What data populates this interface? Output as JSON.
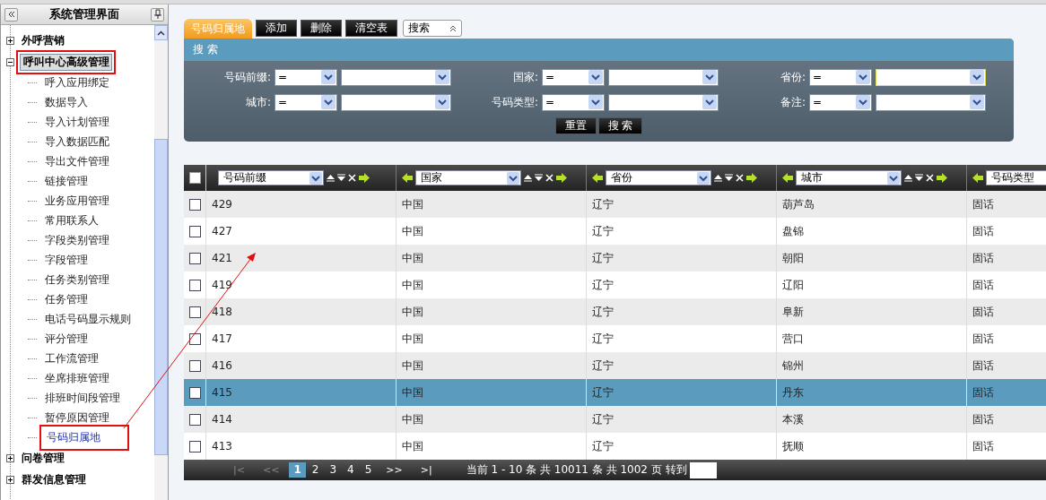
{
  "sidebar": {
    "title": "系统管理界面",
    "items": [
      {
        "label": "外呼营销",
        "expanded": false,
        "selected": false,
        "annotated": false
      },
      {
        "label": "呼叫中心高级管理",
        "expanded": true,
        "selected": true,
        "annotated": true,
        "children": [
          {
            "label": "呼入应用绑定",
            "selected": false,
            "annotated": false
          },
          {
            "label": "数据导入",
            "selected": false,
            "annotated": false
          },
          {
            "label": "导入计划管理",
            "selected": false,
            "annotated": false
          },
          {
            "label": "导入数据匹配",
            "selected": false,
            "annotated": false
          },
          {
            "label": "导出文件管理",
            "selected": false,
            "annotated": false
          },
          {
            "label": "链接管理",
            "selected": false,
            "annotated": false
          },
          {
            "label": "业务应用管理",
            "selected": false,
            "annotated": false
          },
          {
            "label": "常用联系人",
            "selected": false,
            "annotated": false
          },
          {
            "label": "字段类别管理",
            "selected": false,
            "annotated": false
          },
          {
            "label": "字段管理",
            "selected": false,
            "annotated": false
          },
          {
            "label": "任务类别管理",
            "selected": false,
            "annotated": false
          },
          {
            "label": "任务管理",
            "selected": false,
            "annotated": false
          },
          {
            "label": "电话号码显示规则",
            "selected": false,
            "annotated": false
          },
          {
            "label": "评分管理",
            "selected": false,
            "annotated": false
          },
          {
            "label": "工作流管理",
            "selected": false,
            "annotated": false
          },
          {
            "label": "坐席排班管理",
            "selected": false,
            "annotated": false
          },
          {
            "label": "排班时间段管理",
            "selected": false,
            "annotated": false
          },
          {
            "label": "暂停原因管理",
            "selected": false,
            "annotated": false
          },
          {
            "label": "号码归属地",
            "selected": true,
            "annotated": true
          }
        ]
      },
      {
        "label": "问卷管理",
        "expanded": false,
        "selected": false,
        "annotated": false
      },
      {
        "label": "群发信息管理",
        "expanded": false,
        "selected": false,
        "annotated": false
      }
    ]
  },
  "toolbar": {
    "tabs": [
      {
        "label": "号码归属地",
        "selected": true
      }
    ],
    "buttons": [
      "添加",
      "删除",
      "清空表"
    ],
    "search_toggle": "搜索"
  },
  "search_panel": {
    "title": "搜 索",
    "fields": [
      {
        "label": "号码前缀:",
        "operator": "=",
        "focused": false
      },
      {
        "label": "国家:",
        "operator": "=",
        "focused": false
      },
      {
        "label": "省份:",
        "operator": "=",
        "focused": true
      },
      {
        "label": "城市:",
        "operator": "=",
        "focused": false
      },
      {
        "label": "号码类型:",
        "operator": "=",
        "focused": false
      },
      {
        "label": "备注:",
        "operator": "=",
        "focused": false
      }
    ],
    "buttons": [
      "重置",
      "搜 索"
    ]
  },
  "table": {
    "select_all": {
      "checked": false
    },
    "columns": [
      {
        "label": "号码前缀",
        "movable_left": false
      },
      {
        "label": "国家",
        "movable_left": true
      },
      {
        "label": "省份",
        "movable_left": true
      },
      {
        "label": "城市",
        "movable_left": true
      },
      {
        "label": "号码类型",
        "movable_left": true
      }
    ],
    "rows": [
      {
        "selected": false,
        "checked": false,
        "cells": [
          "429",
          "中国",
          "辽宁",
          "葫芦岛",
          "固话"
        ]
      },
      {
        "selected": false,
        "checked": false,
        "cells": [
          "427",
          "中国",
          "辽宁",
          "盘锦",
          "固话"
        ]
      },
      {
        "selected": false,
        "checked": false,
        "cells": [
          "421",
          "中国",
          "辽宁",
          "朝阳",
          "固话"
        ]
      },
      {
        "selected": false,
        "checked": false,
        "cells": [
          "419",
          "中国",
          "辽宁",
          "辽阳",
          "固话"
        ]
      },
      {
        "selected": false,
        "checked": false,
        "cells": [
          "418",
          "中国",
          "辽宁",
          "阜新",
          "固话"
        ]
      },
      {
        "selected": false,
        "checked": false,
        "cells": [
          "417",
          "中国",
          "辽宁",
          "营口",
          "固话"
        ]
      },
      {
        "selected": false,
        "checked": false,
        "cells": [
          "416",
          "中国",
          "辽宁",
          "锦州",
          "固话"
        ]
      },
      {
        "selected": true,
        "checked": false,
        "cells": [
          "415",
          "中国",
          "辽宁",
          "丹东",
          "固话"
        ]
      },
      {
        "selected": false,
        "checked": false,
        "cells": [
          "414",
          "中国",
          "辽宁",
          "本溪",
          "固话"
        ]
      },
      {
        "selected": false,
        "checked": false,
        "cells": [
          "413",
          "中国",
          "辽宁",
          "抚顺",
          "固话"
        ]
      }
    ]
  },
  "pager": {
    "first": {
      "label": "|<",
      "disabled": true
    },
    "prev": {
      "label": "<<",
      "disabled": true
    },
    "pages": [
      {
        "label": "1",
        "selected": true
      },
      {
        "label": "2",
        "selected": false
      },
      {
        "label": "3",
        "selected": false
      },
      {
        "label": "4",
        "selected": false
      },
      {
        "label": "5",
        "selected": false
      }
    ],
    "next": {
      "label": ">>",
      "disabled": false
    },
    "last": {
      "label": ">|",
      "disabled": false
    },
    "info": "当前 1 - 10 条 共 10011 条 共 1002 页 转到"
  }
}
